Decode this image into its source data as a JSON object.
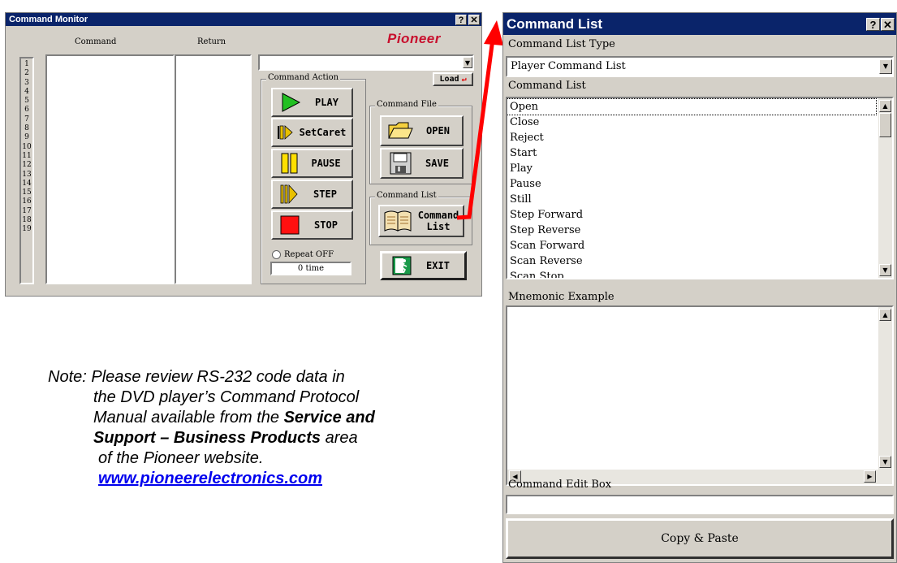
{
  "monitor": {
    "title": "Command Monitor",
    "help_btn": "?",
    "close_btn": "✕",
    "brand": "Pioneer",
    "col_command": "Command",
    "col_return": "Return",
    "line_numbers": [
      "1",
      "2",
      "3",
      "4",
      "5",
      "6",
      "7",
      "8",
      "9",
      "10",
      "11",
      "12",
      "13",
      "14",
      "15",
      "16",
      "17",
      "18",
      "19"
    ],
    "load_label": "Load",
    "action_group": "Command Action",
    "buttons": {
      "play": "PLAY",
      "setcaret": "SetCaret",
      "pause": "PAUSE",
      "step": "STEP",
      "stop": "STOP"
    },
    "repeat_label": "Repeat OFF",
    "repeat_count": "0 time",
    "file_group": "Command File",
    "open_label": "OPEN",
    "save_label": "SAVE",
    "list_group": "Command List",
    "command_list_line1": "Command",
    "command_list_line2": "List",
    "exit_label": "EXIT"
  },
  "cmdlist": {
    "title": "Command List",
    "help_btn": "?",
    "close_btn": "✕",
    "type_label": "Command List Type",
    "type_value": "Player Command List",
    "list_label": "Command List",
    "items": [
      "Open",
      "Close",
      "Reject",
      "Start",
      "Play",
      "Pause",
      "Still",
      "Step Forward",
      "Step Reverse",
      "Scan Forward",
      "Scan Reverse",
      "Scan Stop"
    ],
    "mnemonic_label": "Mnemonic Example",
    "edit_label": "Command Edit Box",
    "copy_paste": "Copy & Paste"
  },
  "note": {
    "prefix": "Note:",
    "line1": "Please review RS-232 code data in",
    "line2": "the DVD player’s Command Protocol",
    "line3a": "Manual available from the ",
    "line3b": "Service and",
    "line4a": "Support – Business Products",
    "line4b": " area",
    "line5": "of the Pioneer website.",
    "link": "www.pioneerelectronics.com"
  },
  "colors": {
    "title_bar": "#0a246a",
    "arrow": "#ff0000",
    "window_face": "#d4d0c8"
  }
}
